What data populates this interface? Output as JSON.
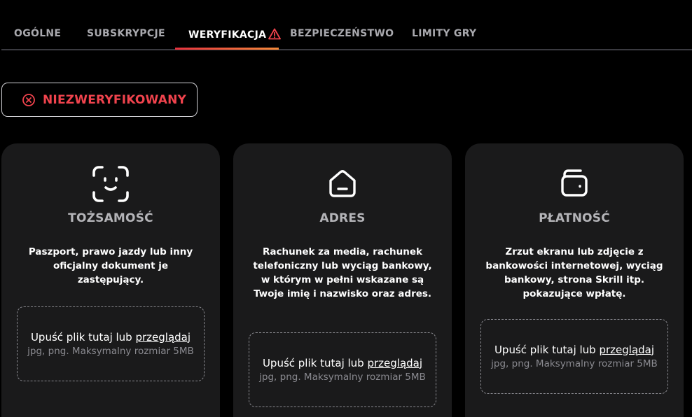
{
  "tabs": [
    {
      "label": "OGÓLNE",
      "active": false
    },
    {
      "label": "SUBSKRYPCJE",
      "active": false
    },
    {
      "label": "WERYFIKACJA",
      "active": true,
      "icon": "warning-triangle-icon"
    },
    {
      "label": "BEZPIECZEŃSTWO",
      "active": false
    },
    {
      "label": "LIMITY GRY",
      "active": false
    }
  ],
  "status": {
    "label": "NIEZWERYFIKOWANY",
    "icon": "x-circle-icon",
    "color": "#f0434d"
  },
  "cards": [
    {
      "icon": "face-scan-icon",
      "title": "TOŻSAMOŚĆ",
      "description": "Paszport, prawo jazdy lub inny oficjalny dokument je zastępujący.",
      "dropzone": {
        "text": "Upuść plik tutaj lub",
        "link": "przeglądaj",
        "hint": "jpg, png. Maksymalny rozmiar 5MB"
      }
    },
    {
      "icon": "home-icon",
      "title": "ADRES",
      "description": "Rachunek za media, rachunek telefoniczny lub wyciąg bankowy, w którym w pełni wskazane są Twoje imię i nazwisko oraz adres.",
      "dropzone": {
        "text": "Upuść plik tutaj lub",
        "link": "przeglądaj",
        "hint": "jpg, png. Maksymalny rozmiar 5MB"
      }
    },
    {
      "icon": "wallet-icon",
      "title": "PŁATNOŚĆ",
      "description": "Zrzut ekranu lub zdjęcie z bankowości internetowej, wyciąg bankowy, strona Skrill itp. pokazujące wpłatę.",
      "dropzone": {
        "text": "Upuść plik tutaj lub",
        "link": "przeglądaj",
        "hint": "jpg, png. Maksymalny rozmiar 5MB"
      }
    }
  ],
  "colors": {
    "accent_gradient_start": "#e8323e",
    "accent_gradient_end": "#f58a3a",
    "card_bg": "#1a1a1b"
  }
}
